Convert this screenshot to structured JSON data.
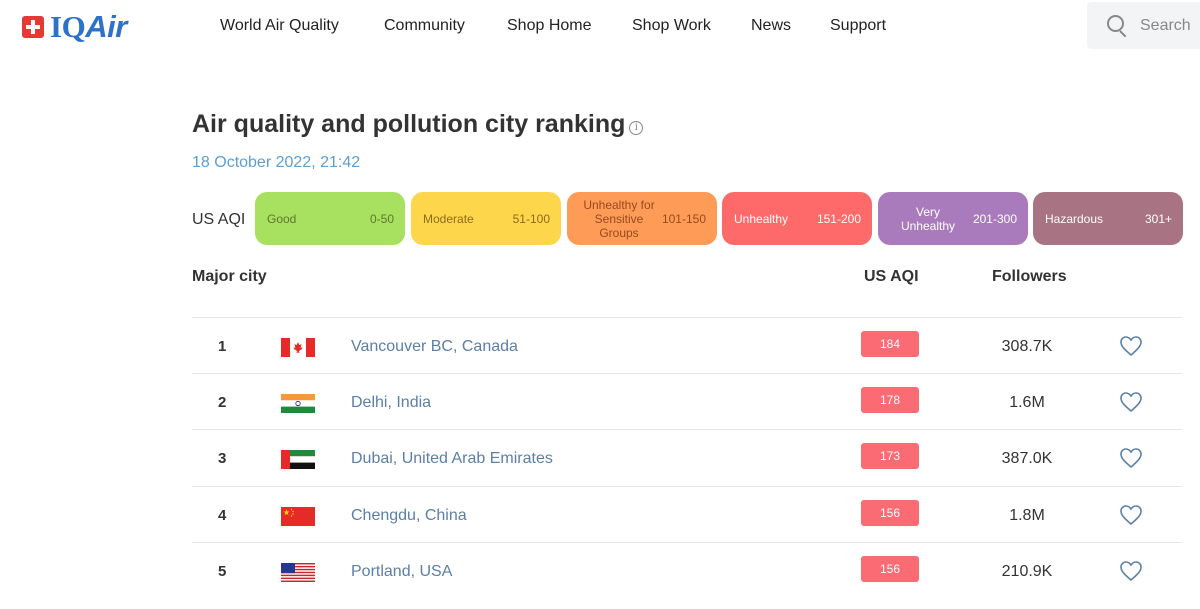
{
  "header": {
    "logo": {
      "prefix": "IQ",
      "suffix": "Air"
    },
    "nav": [
      {
        "label": "World Air Quality"
      },
      {
        "label": "Community"
      },
      {
        "label": "Shop Home"
      },
      {
        "label": "Shop Work"
      },
      {
        "label": "News"
      },
      {
        "label": "Support"
      }
    ],
    "search": {
      "placeholder": "Search"
    }
  },
  "page": {
    "title": "Air quality and pollution city ranking",
    "info_icon_text": "i",
    "timestamp": "18 October 2022, 21:42"
  },
  "legend": {
    "label": "US AQI",
    "levels": [
      {
        "name": "Good",
        "range": "0-50",
        "color": "#a8e05f",
        "text_color": "#607631"
      },
      {
        "name": "Moderate",
        "range": "51-100",
        "color": "#fdd64b",
        "text_color": "#8c6c1d"
      },
      {
        "name": "Unhealthy for Sensitive Groups",
        "range": "101-150",
        "color": "#fe9b57",
        "text_color": "#974a20"
      },
      {
        "name": "Unhealthy",
        "range": "151-200",
        "color": "#fe6a69",
        "text_color": "#ffffff"
      },
      {
        "name": "Very Unhealthy",
        "range": "201-300",
        "color": "#a97abc",
        "text_color": "#ffffff"
      },
      {
        "name": "Hazardous",
        "range": "301+",
        "color": "#a87383",
        "text_color": "#ffffff"
      }
    ]
  },
  "table": {
    "headers": {
      "city": "Major city",
      "aqi": "US AQI",
      "followers": "Followers"
    },
    "rows": [
      {
        "rank": "1",
        "flag": "canada-flag-icon",
        "city": "Vancouver BC, Canada",
        "aqi": "184",
        "followers": "308.7K"
      },
      {
        "rank": "2",
        "flag": "india-flag-icon",
        "city": "Delhi, India",
        "aqi": "178",
        "followers": "1.6M"
      },
      {
        "rank": "3",
        "flag": "uae-flag-icon",
        "city": "Dubai, United Arab Emirates",
        "aqi": "173",
        "followers": "387.0K"
      },
      {
        "rank": "4",
        "flag": "china-flag-icon",
        "city": "Chengdu, China",
        "aqi": "156",
        "followers": "1.8M"
      },
      {
        "rank": "5",
        "flag": "usa-flag-icon",
        "city": "Portland, USA",
        "aqi": "156",
        "followers": "210.9K"
      }
    ],
    "badge_color": "#fa6b74"
  }
}
